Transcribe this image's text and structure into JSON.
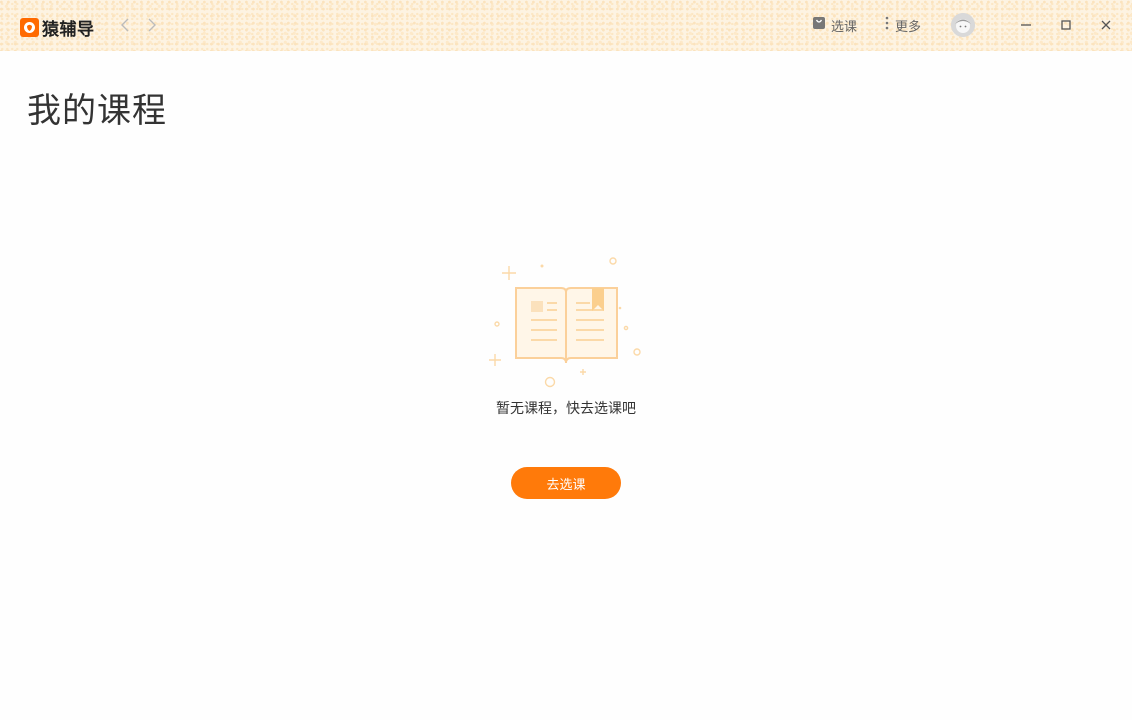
{
  "app": {
    "name": "猿辅导",
    "brand_color": "#ff6a00"
  },
  "titlebar": {
    "back_icon": "chevron-left-icon",
    "forward_icon": "chevron-right-icon",
    "select_course_label": "选课",
    "more_label": "更多"
  },
  "page": {
    "title": "我的课程",
    "empty_message": "暂无课程，快去选课吧",
    "cta_label": "去选课",
    "cta_color": "#ff7a0a"
  }
}
